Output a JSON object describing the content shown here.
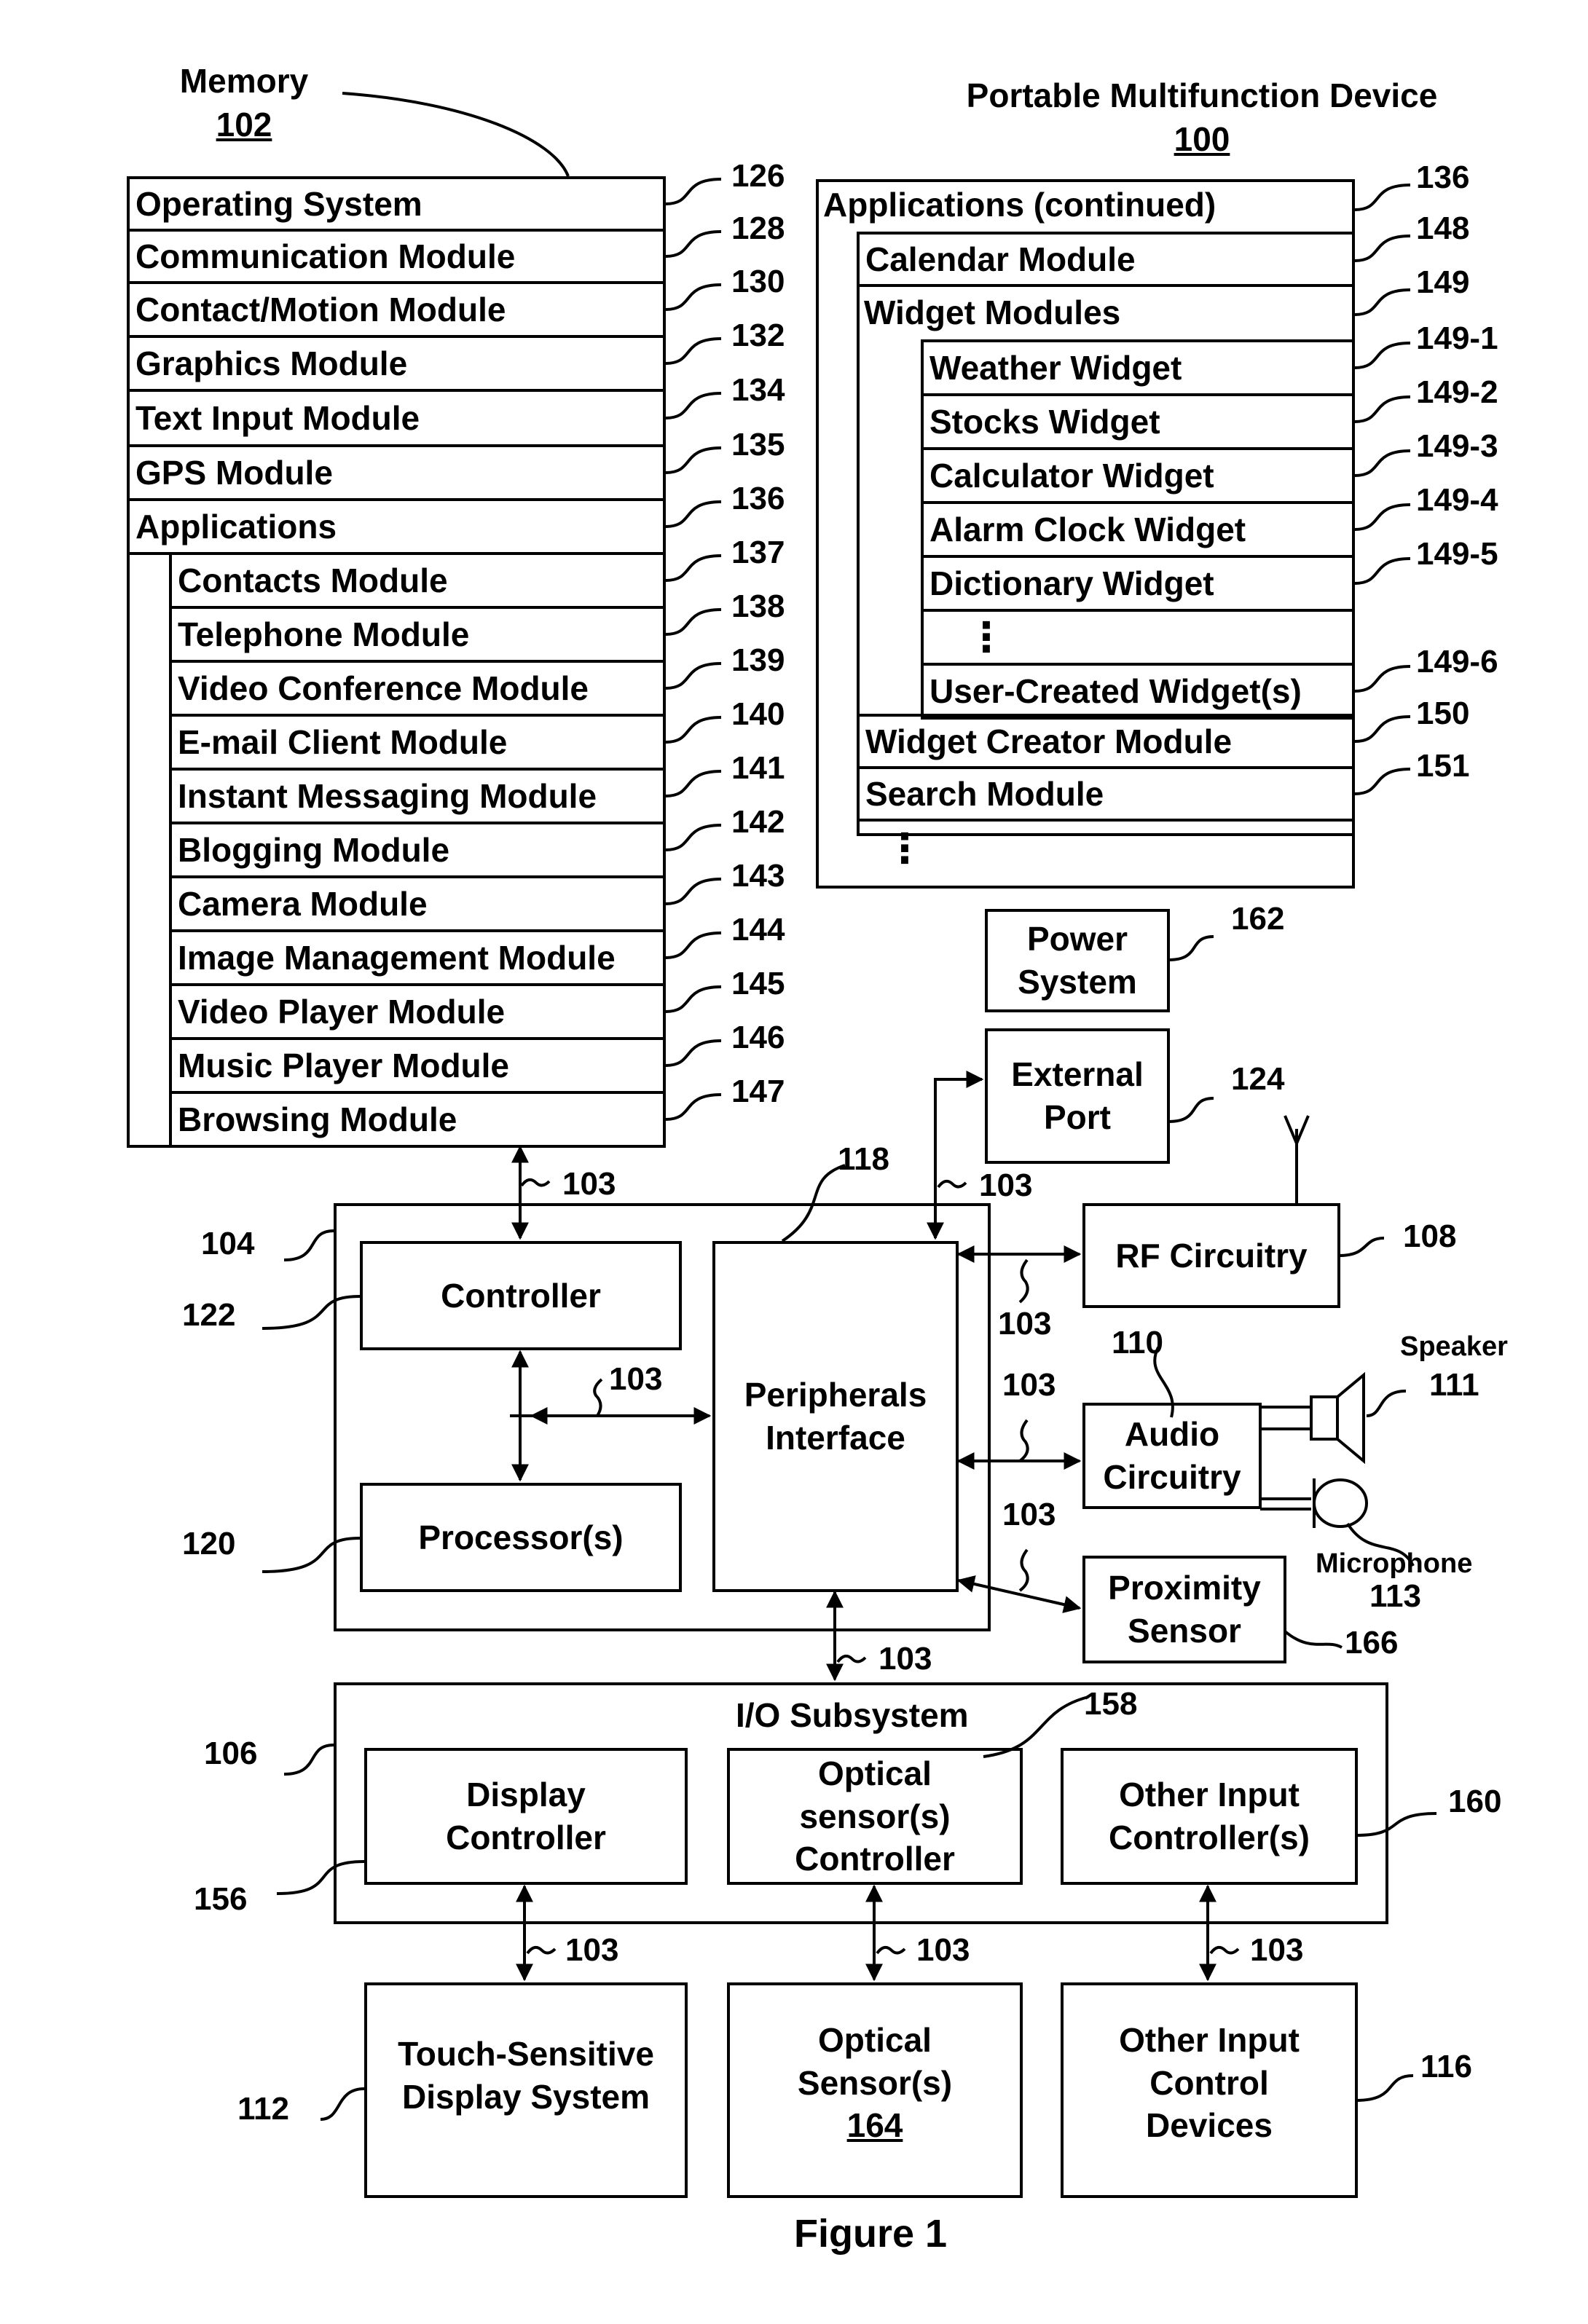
{
  "figure_caption": "Figure 1",
  "memory": {
    "title": "Memory",
    "ref": "102",
    "rows": [
      {
        "label": "Operating System",
        "ref": "126"
      },
      {
        "label": "Communication Module",
        "ref": "128"
      },
      {
        "label": "Contact/Motion Module",
        "ref": "130"
      },
      {
        "label": "Graphics Module",
        "ref": "132"
      },
      {
        "label": "Text Input Module",
        "ref": "134"
      },
      {
        "label": "GPS Module",
        "ref": "135"
      },
      {
        "label": "Applications",
        "ref": "136"
      }
    ],
    "applications": [
      {
        "label": "Contacts Module",
        "ref": "137"
      },
      {
        "label": "Telephone Module",
        "ref": "138"
      },
      {
        "label": "Video Conference Module",
        "ref": "139"
      },
      {
        "label": "E-mail Client Module",
        "ref": "140"
      },
      {
        "label": "Instant Messaging Module",
        "ref": "141"
      },
      {
        "label": "Blogging Module",
        "ref": "142"
      },
      {
        "label": "Camera Module",
        "ref": "143"
      },
      {
        "label": "Image Management Module",
        "ref": "144"
      },
      {
        "label": "Video Player Module",
        "ref": "145"
      },
      {
        "label": "Music Player Module",
        "ref": "146"
      },
      {
        "label": "Browsing Module",
        "ref": "147"
      }
    ]
  },
  "device": {
    "title": "Portable Multifunction Device",
    "ref": "100",
    "applications_continued": {
      "label": "Applications (continued)",
      "ref": "136"
    },
    "calendar": {
      "label": "Calendar Module",
      "ref": "148"
    },
    "widget_modules": {
      "label": "Widget Modules",
      "ref": "149"
    },
    "widgets": [
      {
        "label": "Weather Widget",
        "ref": "149-1"
      },
      {
        "label": "Stocks Widget",
        "ref": "149-2"
      },
      {
        "label": "Calculator Widget",
        "ref": "149-3"
      },
      {
        "label": "Alarm Clock Widget",
        "ref": "149-4"
      },
      {
        "label": "Dictionary Widget",
        "ref": "149-5"
      },
      {
        "label": "⋮",
        "ref": ""
      },
      {
        "label": "User-Created Widget(s)",
        "ref": "149-6"
      }
    ],
    "widget_creator": {
      "label": "Widget Creator Module",
      "ref": "150"
    },
    "search": {
      "label": "Search Module",
      "ref": "151"
    },
    "ellipsis": "⋮"
  },
  "components": {
    "power_system": {
      "line1": "Power",
      "line2": "System",
      "ref": "162"
    },
    "external_port": {
      "line1": "External",
      "line2": "Port",
      "ref": "124"
    },
    "rf_circuitry": {
      "label": "RF Circuitry",
      "ref": "108"
    },
    "audio_circuitry": {
      "line1": "Audio",
      "line2": "Circuitry",
      "ref": "110"
    },
    "speaker": {
      "label": "Speaker",
      "ref": "111"
    },
    "microphone": {
      "label": "Microphone",
      "ref": "113"
    },
    "proximity_sensor": {
      "line1": "Proximity",
      "line2": "Sensor",
      "ref": "166"
    },
    "chip_ref": "104",
    "controller": {
      "label": "Controller",
      "ref": "122"
    },
    "processor": {
      "label": "Processor(s)",
      "ref": "120"
    },
    "peripherals_interface": {
      "line1": "Peripherals",
      "line2": "Interface",
      "ref": "118"
    },
    "bus_ref": "103",
    "io_subsystem": {
      "label": "I/O Subsystem",
      "ref": "106"
    },
    "display_controller": {
      "line1": "Display",
      "line2": "Controller",
      "ref": "156"
    },
    "optical_controller": {
      "line1": "Optical",
      "line2": "sensor(s)",
      "line3": "Controller",
      "ref": "158"
    },
    "other_input_controller": {
      "line1": "Other Input",
      "line2": "Controller(s)",
      "ref": "160"
    },
    "touch_display": {
      "line1": "Touch-Sensitive",
      "line2": "Display System",
      "ref": "112"
    },
    "optical_sensor": {
      "line1": "Optical",
      "line2": "Sensor(s)",
      "ref": "164"
    },
    "other_input_devices": {
      "line1": "Other Input",
      "line2": "Control",
      "line3": "Devices",
      "ref": "116"
    }
  }
}
